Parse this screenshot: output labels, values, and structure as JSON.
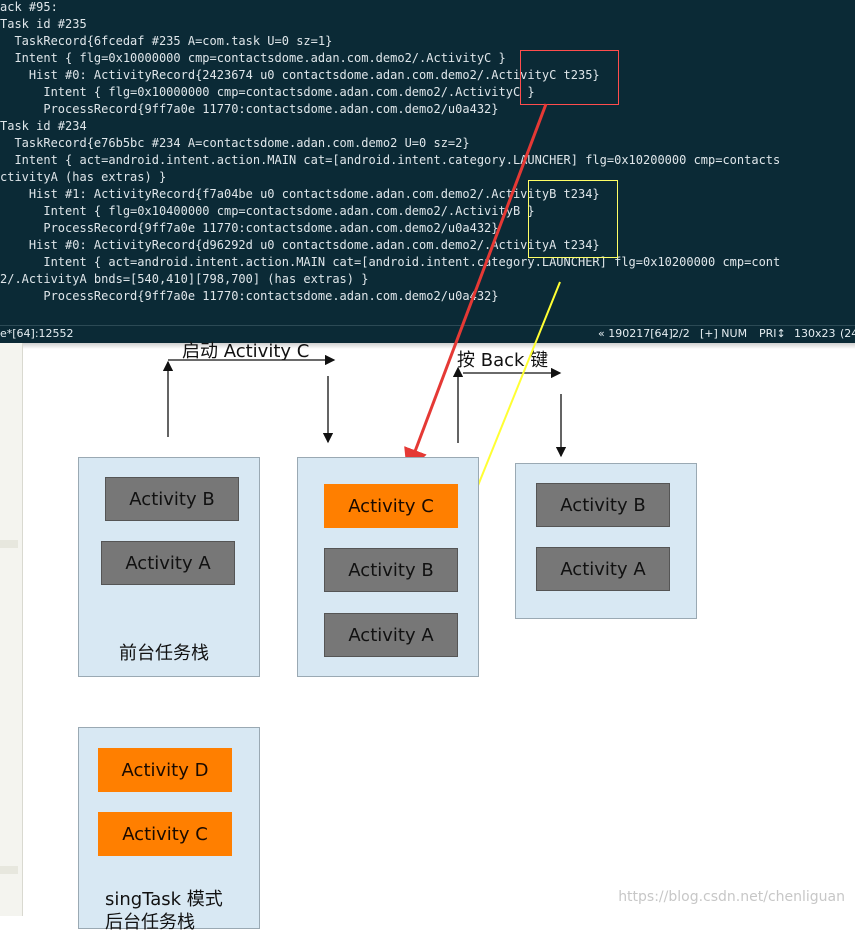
{
  "terminal": {
    "lines": [
      "ack #95:",
      "Task id #235",
      "  TaskRecord{6fcedaf #235 A=com.task U=0 sz=1}",
      "  Intent { flg=0x10000000 cmp=contactsdome.adan.com.demo2/.ActivityC }",
      "    Hist #0: ActivityRecord{2423674 u0 contactsdome.adan.com.demo2/.ActivityC t235}",
      "      Intent { flg=0x10000000 cmp=contactsdome.adan.com.demo2/.ActivityC }",
      "      ProcessRecord{9ff7a0e 11770:contactsdome.adan.com.demo2/u0a432}",
      "Task id #234",
      "  TaskRecord{e76b5bc #234 A=contactsdome.adan.com.demo2 U=0 sz=2}",
      "  Intent { act=android.intent.action.MAIN cat=[android.intent.category.LAUNCHER] flg=0x10200000 cmp=contacts",
      "ctivityA (has extras) }",
      "    Hist #1: ActivityRecord{f7a04be u0 contactsdome.adan.com.demo2/.ActivityB t234}",
      "      Intent { flg=0x10400000 cmp=contactsdome.adan.com.demo2/.ActivityB }",
      "      ProcessRecord{9ff7a0e 11770:contactsdome.adan.com.demo2/u0a432}",
      "    Hist #0: ActivityRecord{d96292d u0 contactsdome.adan.com.demo2/.ActivityA t234}",
      "      Intent { act=android.intent.action.MAIN cat=[android.intent.category.LAUNCHER] flg=0x10200000 cmp=cont",
      "2/.ActivityA bnds=[540,410][798,700] (has extras) }",
      "      ProcessRecord{9ff7a0e 11770:contactsdome.adan.com.demo2/u0a432}"
    ],
    "status_left": "e*[64]:12552",
    "status_pos": "« 190217[64]",
    "status_page": "2/2",
    "status_mode": "[+] NUM",
    "status_pri": "PRI↕",
    "status_size": "130x23",
    "status_end": "(24"
  },
  "diagram": {
    "launch_label": "启动 Activity C",
    "back_label": "按 Back 键",
    "stack1": {
      "top": "Activity B",
      "bottom": "Activity A",
      "caption": "前台任务栈"
    },
    "stack2": {
      "top": "Activity C",
      "middle": "Activity B",
      "bottom": "Activity A"
    },
    "stack3": {
      "top": "Activity B",
      "bottom": "Activity A"
    },
    "stack4": {
      "top": "Activity D",
      "bottom": "Activity C",
      "caption": "singTask 模式",
      "caption2": "后台任务栈"
    }
  },
  "colors": {
    "terminal_bg": "#0b2a36",
    "activity_orange": "#ff7f00",
    "activity_gray": "#777777",
    "stack_bg": "#d8e8f3",
    "arrow_red": "#e53935",
    "arrow_yellow": "#ffff33"
  },
  "watermark": "https://blog.csdn.net/chenliguan"
}
